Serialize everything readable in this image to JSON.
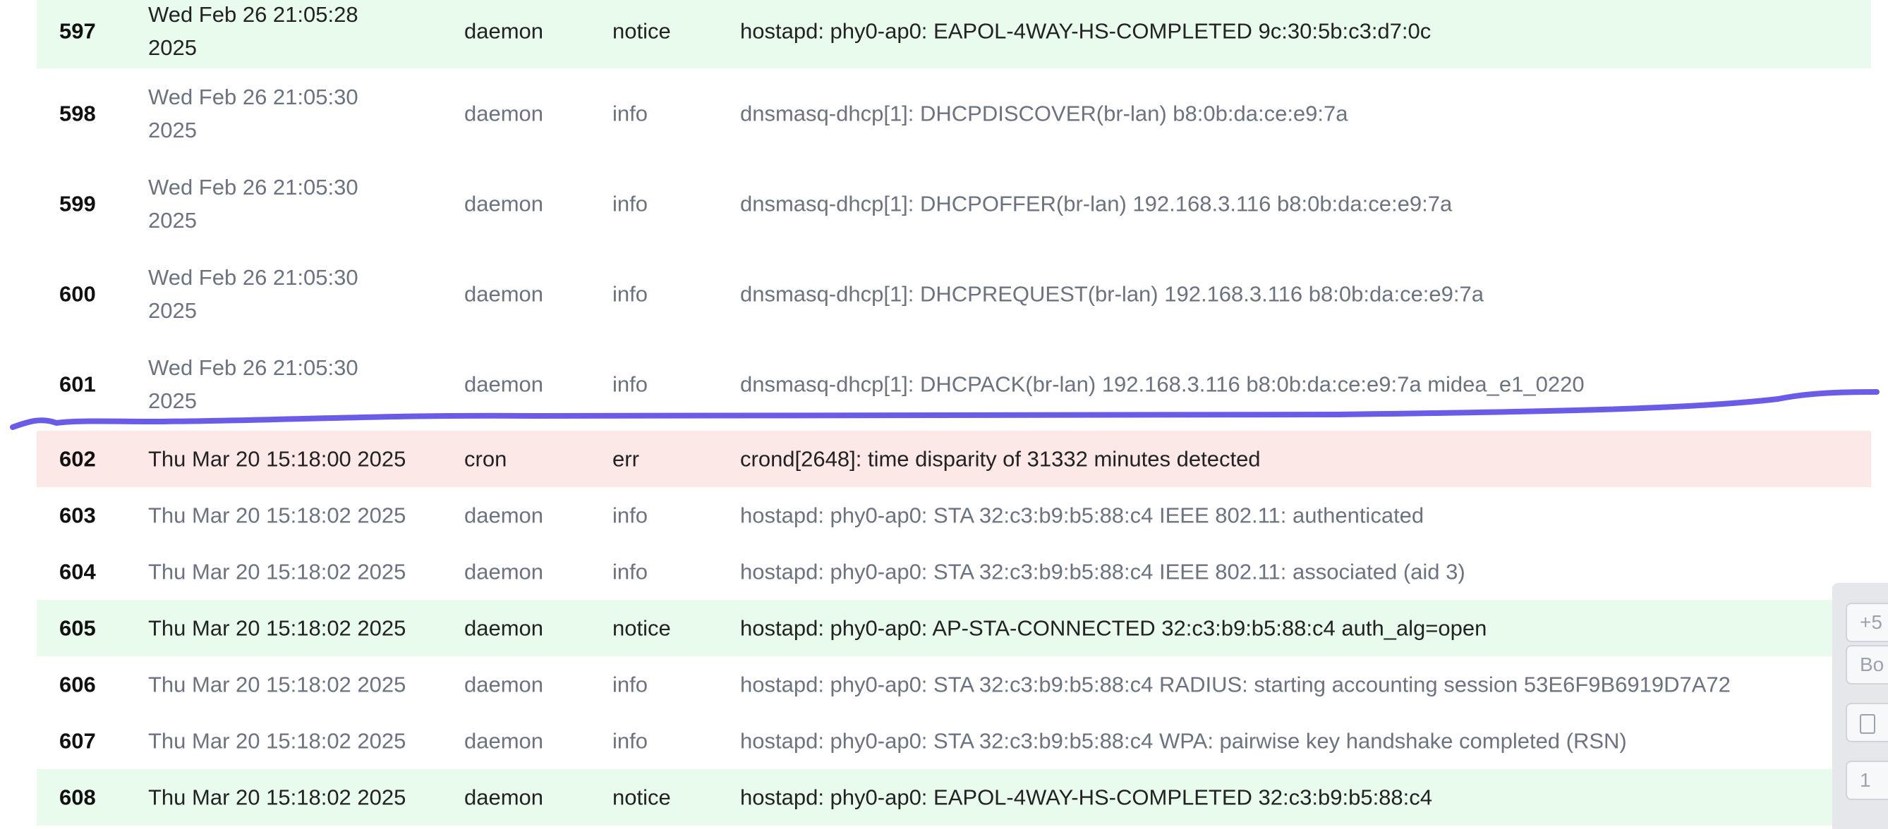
{
  "accent": {
    "notice_row_bg": "#e8fbec",
    "err_row_bg": "#fde8e8",
    "annotation_stroke": "#6b5ce7"
  },
  "log": {
    "rows": [
      {
        "num": "597",
        "time": "Wed Feb 26 21:05:28 2025",
        "facility": "daemon",
        "level": "notice",
        "message": "hostapd: phy0-ap0: EAPOL-4WAY-HS-COMPLETED 9c:30:5b:c3:d7:0c"
      },
      {
        "num": "598",
        "time": "Wed Feb 26 21:05:30 2025",
        "facility": "daemon",
        "level": "info",
        "message": "dnsmasq-dhcp[1]: DHCPDISCOVER(br-lan) b8:0b:da:ce:e9:7a"
      },
      {
        "num": "599",
        "time": "Wed Feb 26 21:05:30 2025",
        "facility": "daemon",
        "level": "info",
        "message": "dnsmasq-dhcp[1]: DHCPOFFER(br-lan) 192.168.3.116 b8:0b:da:ce:e9:7a"
      },
      {
        "num": "600",
        "time": "Wed Feb 26 21:05:30 2025",
        "facility": "daemon",
        "level": "info",
        "message": "dnsmasq-dhcp[1]: DHCPREQUEST(br-lan) 192.168.3.116 b8:0b:da:ce:e9:7a"
      },
      {
        "num": "601",
        "time": "Wed Feb 26 21:05:30 2025",
        "facility": "daemon",
        "level": "info",
        "message": "dnsmasq-dhcp[1]: DHCPACK(br-lan) 192.168.3.116 b8:0b:da:ce:e9:7a midea_e1_0220"
      },
      {
        "num": "602",
        "time": "Thu Mar 20 15:18:00 2025",
        "facility": "cron",
        "level": "err",
        "message": "crond[2648]: time disparity of 31332 minutes detected"
      },
      {
        "num": "603",
        "time": "Thu Mar 20 15:18:02 2025",
        "facility": "daemon",
        "level": "info",
        "message": "hostapd: phy0-ap0: STA 32:c3:b9:b5:88:c4 IEEE 802.11: authenticated"
      },
      {
        "num": "604",
        "time": "Thu Mar 20 15:18:02 2025",
        "facility": "daemon",
        "level": "info",
        "message": "hostapd: phy0-ap0: STA 32:c3:b9:b5:88:c4 IEEE 802.11: associated (aid 3)"
      },
      {
        "num": "605",
        "time": "Thu Mar 20 15:18:02 2025",
        "facility": "daemon",
        "level": "notice",
        "message": "hostapd: phy0-ap0: AP-STA-CONNECTED 32:c3:b9:b5:88:c4 auth_alg=open"
      },
      {
        "num": "606",
        "time": "Thu Mar 20 15:18:02 2025",
        "facility": "daemon",
        "level": "info",
        "message": "hostapd: phy0-ap0: STA 32:c3:b9:b5:88:c4 RADIUS: starting accounting session 53E6F9B6919D7A72"
      },
      {
        "num": "607",
        "time": "Thu Mar 20 15:18:02 2025",
        "facility": "daemon",
        "level": "info",
        "message": "hostapd: phy0-ap0: STA 32:c3:b9:b5:88:c4 WPA: pairwise key handshake completed (RSN)"
      },
      {
        "num": "608",
        "time": "Thu Mar 20 15:18:02 2025",
        "facility": "daemon",
        "level": "notice",
        "message": "hostapd: phy0-ap0: EAPOL-4WAY-HS-COMPLETED 32:c3:b9:b5:88:c4"
      }
    ]
  },
  "side_panel": {
    "button_1": "+5",
    "button_2": "Bo",
    "button_3_icon": "checkbox-icon",
    "button_4": "1"
  }
}
